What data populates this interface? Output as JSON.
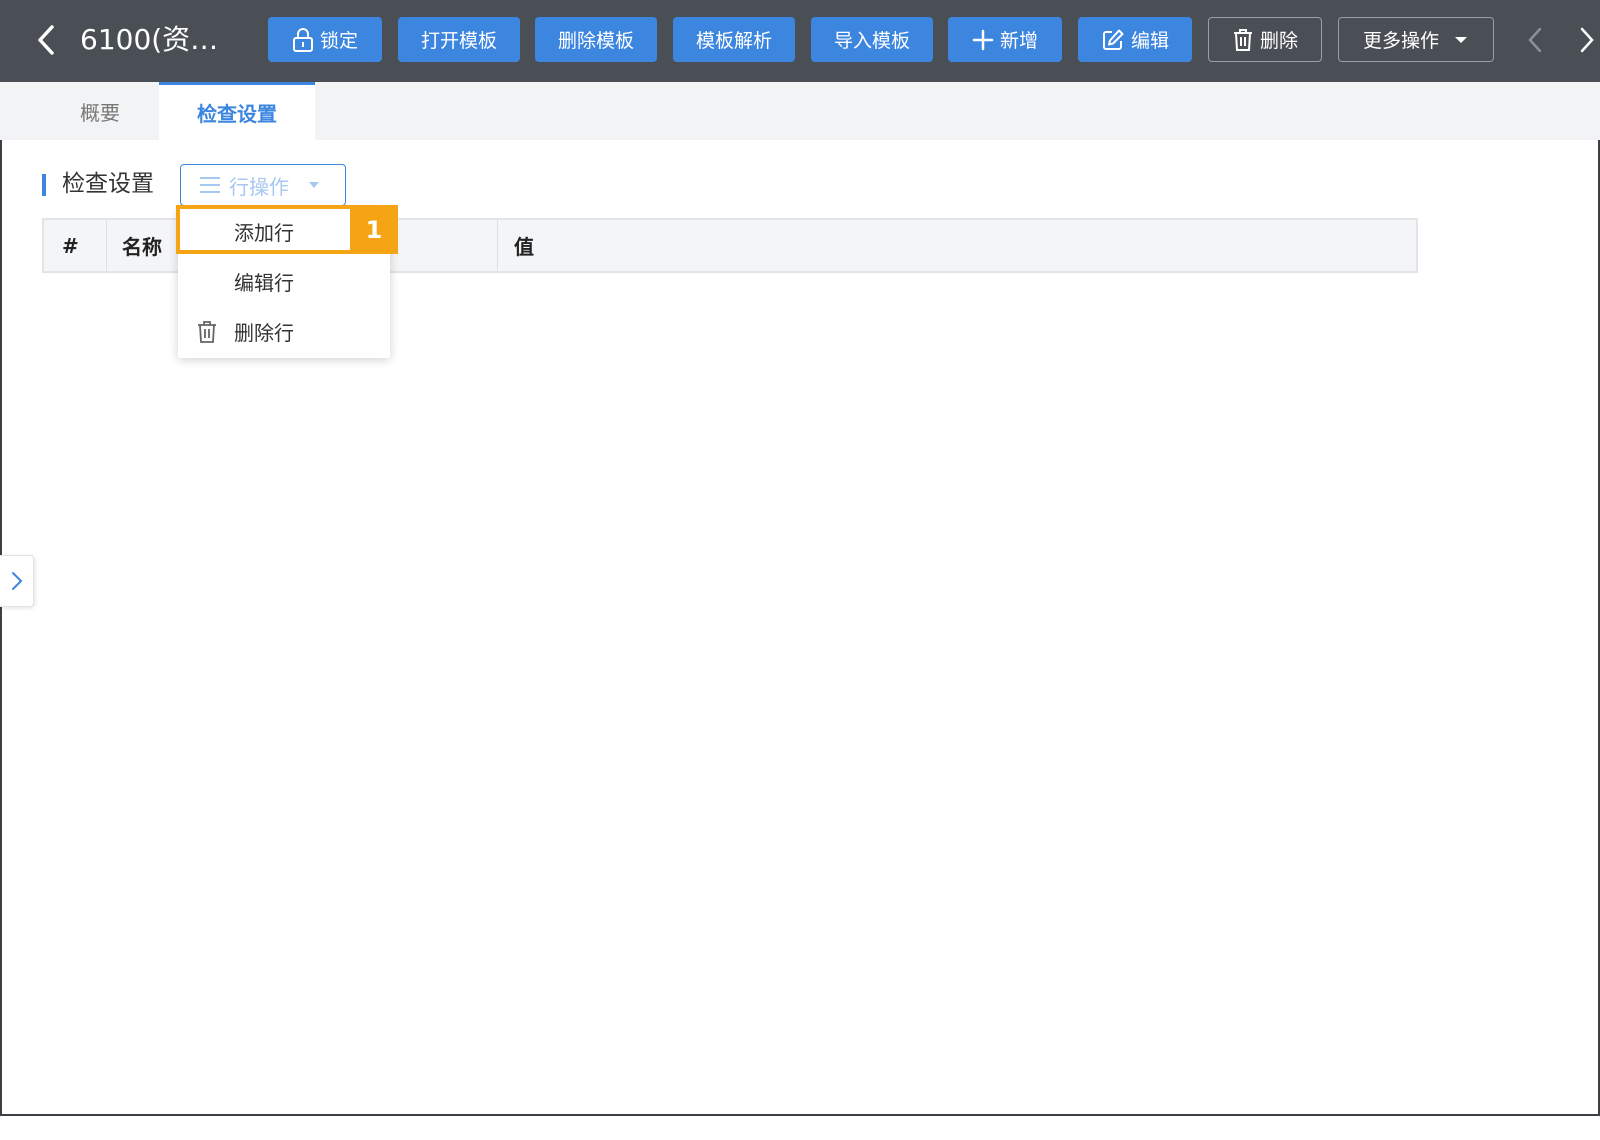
{
  "header": {
    "title": "6100(资…",
    "buttons": {
      "lock": "锁定",
      "open_template": "打开模板",
      "delete_template": "删除模板",
      "parse_template": "模板解析",
      "import_template": "导入模板",
      "add": "新增",
      "edit": "编辑",
      "delete": "删除",
      "more": "更多操作"
    }
  },
  "tabs": [
    {
      "label": "概要",
      "active": false
    },
    {
      "label": "检查设置",
      "active": true
    }
  ],
  "section": {
    "title": "检查设置",
    "row_ops_label": "行操作"
  },
  "table": {
    "columns": [
      "#",
      "名称",
      "值"
    ]
  },
  "menu": {
    "items": [
      {
        "label": "添加行",
        "icon": ""
      },
      {
        "label": "编辑行",
        "icon": ""
      },
      {
        "label": "删除行",
        "icon": "trash-icon"
      }
    ]
  },
  "annotation": {
    "step": "1"
  },
  "colors": {
    "header_bg": "#4a4f55",
    "primary": "#3d86e0",
    "highlight": "#f5a413"
  }
}
